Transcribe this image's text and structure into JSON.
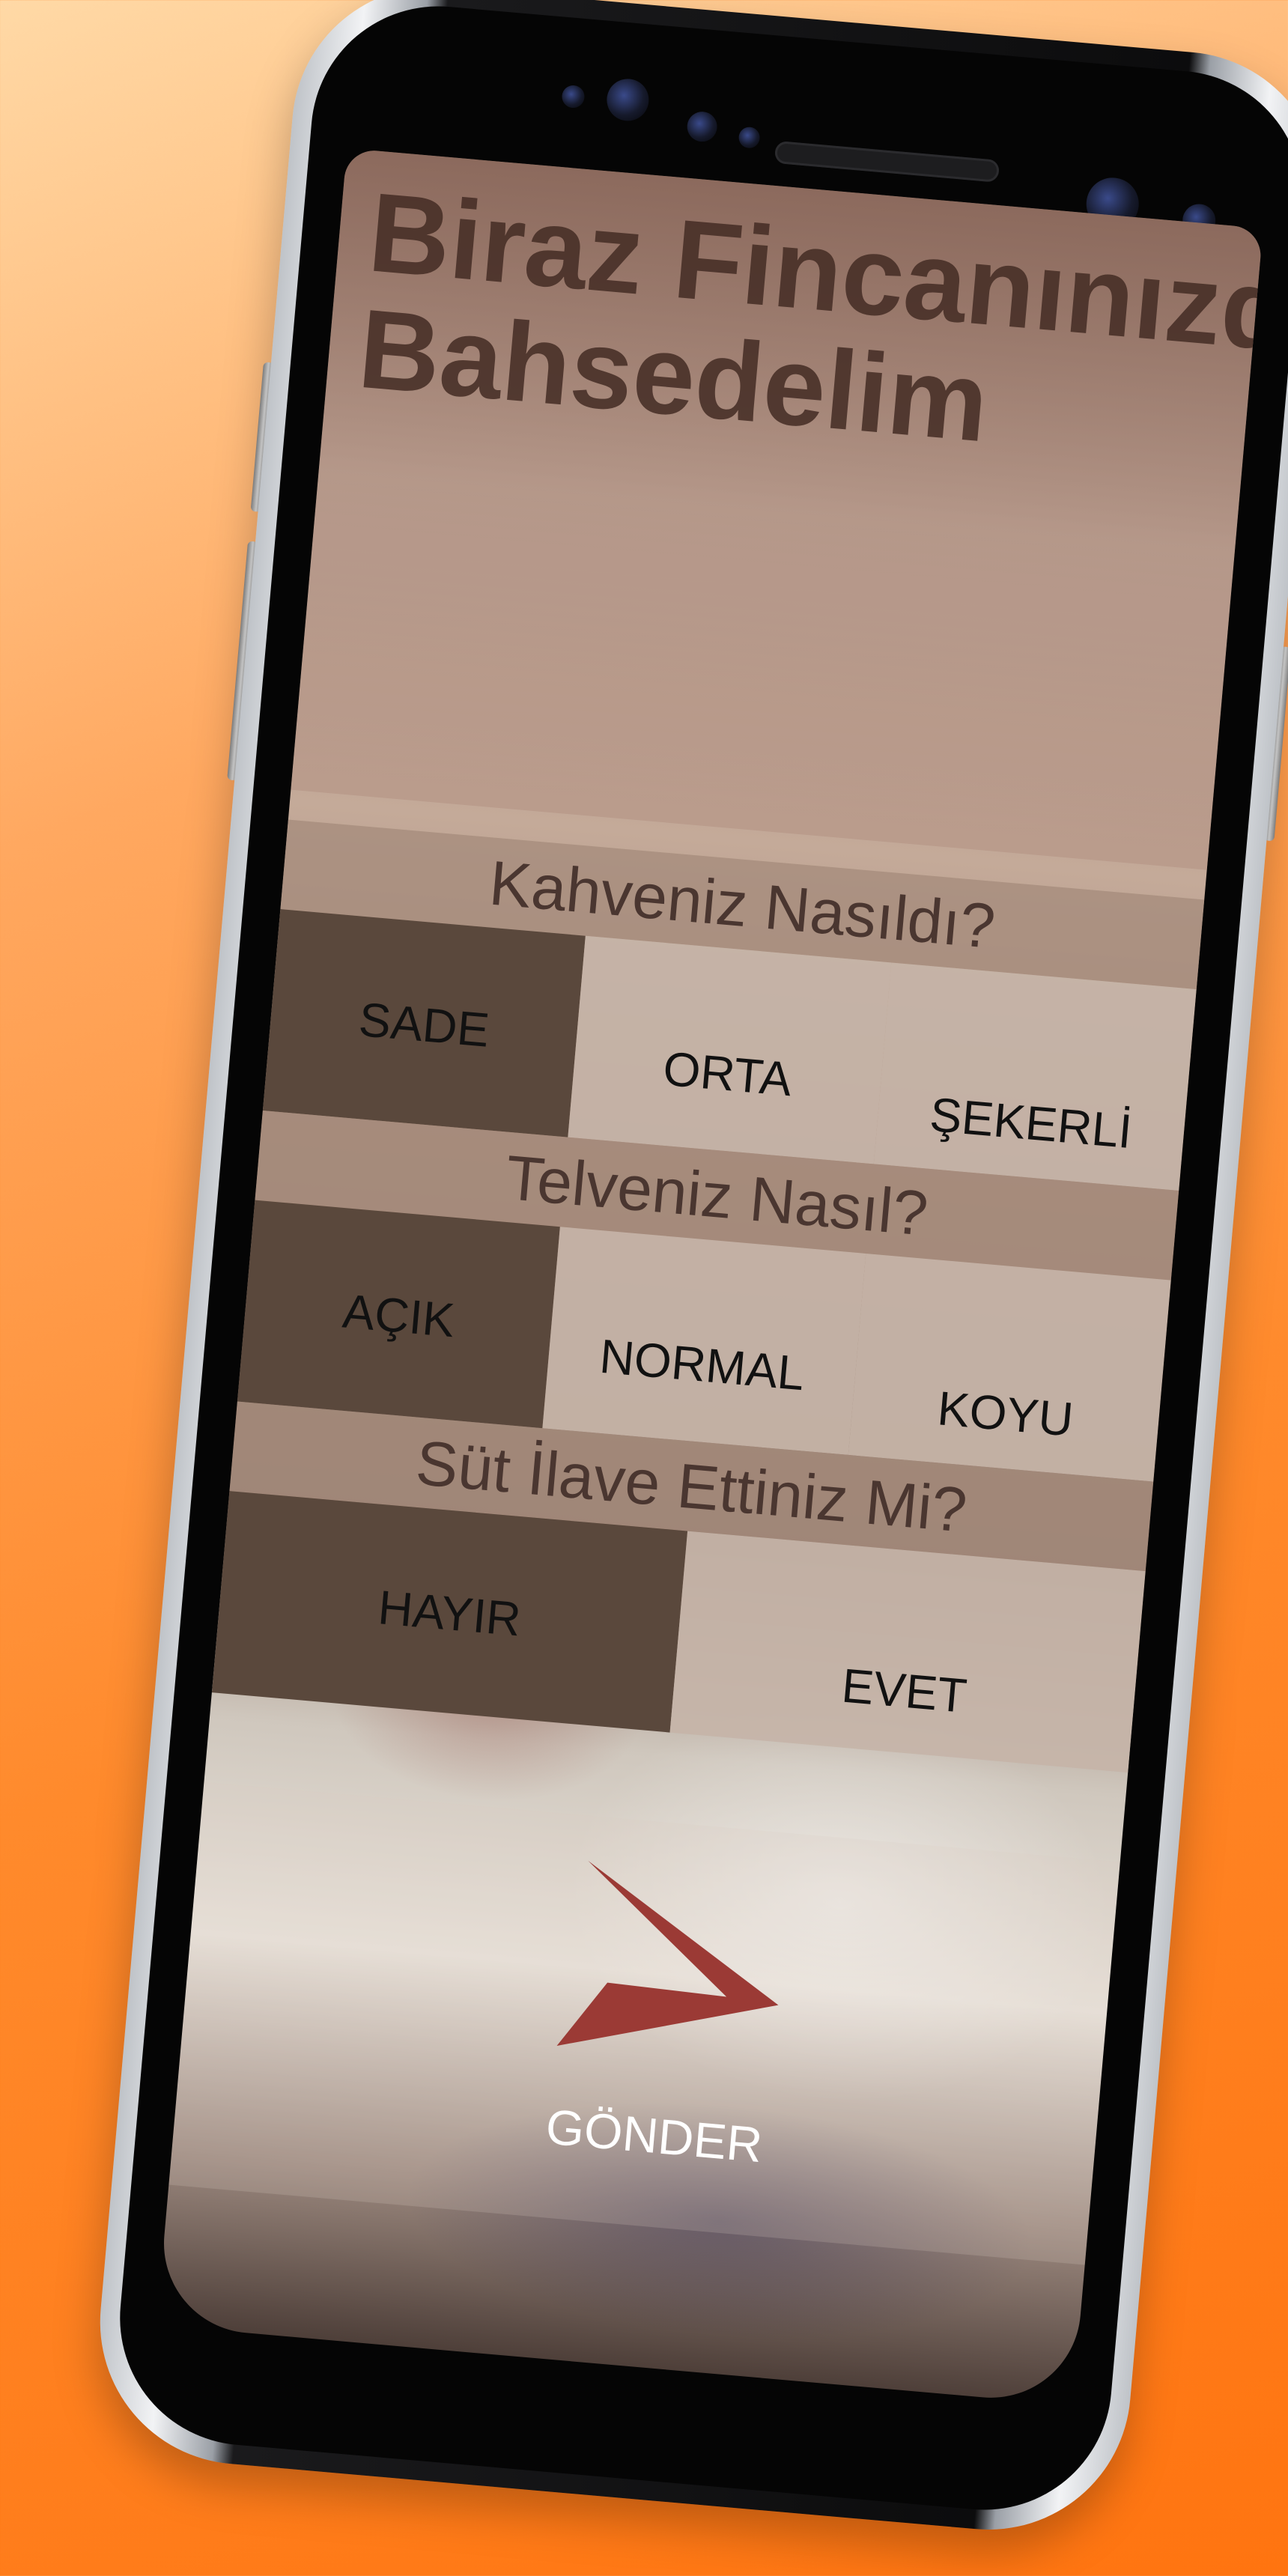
{
  "title": "Biraz Fincanınızdan\nBahsedelim",
  "questions": [
    {
      "label": "Kahveniz Nasıldı?",
      "options": [
        "SADE",
        "ORTA",
        "ŞEKERLİ"
      ],
      "selected": "SADE"
    },
    {
      "label": "Telveniz Nasıl?",
      "options": [
        "AÇIK",
        "NORMAL",
        "KOYU"
      ],
      "selected": "AÇIK"
    },
    {
      "label": "Süt İlave Ettiniz Mi?",
      "options": [
        "HAYIR",
        "EVET"
      ],
      "selected": "HAYIR"
    }
  ],
  "send": {
    "label": "GÖNDER",
    "icon": "send-arrow-icon"
  },
  "colors": {
    "background_top": "#ffd9a6",
    "background_bottom": "#ff7410",
    "selected_option": "#5a483c",
    "option": "#c6b4a8",
    "question_bar": "#a58c7c",
    "send_icon": "#9b3a35"
  }
}
